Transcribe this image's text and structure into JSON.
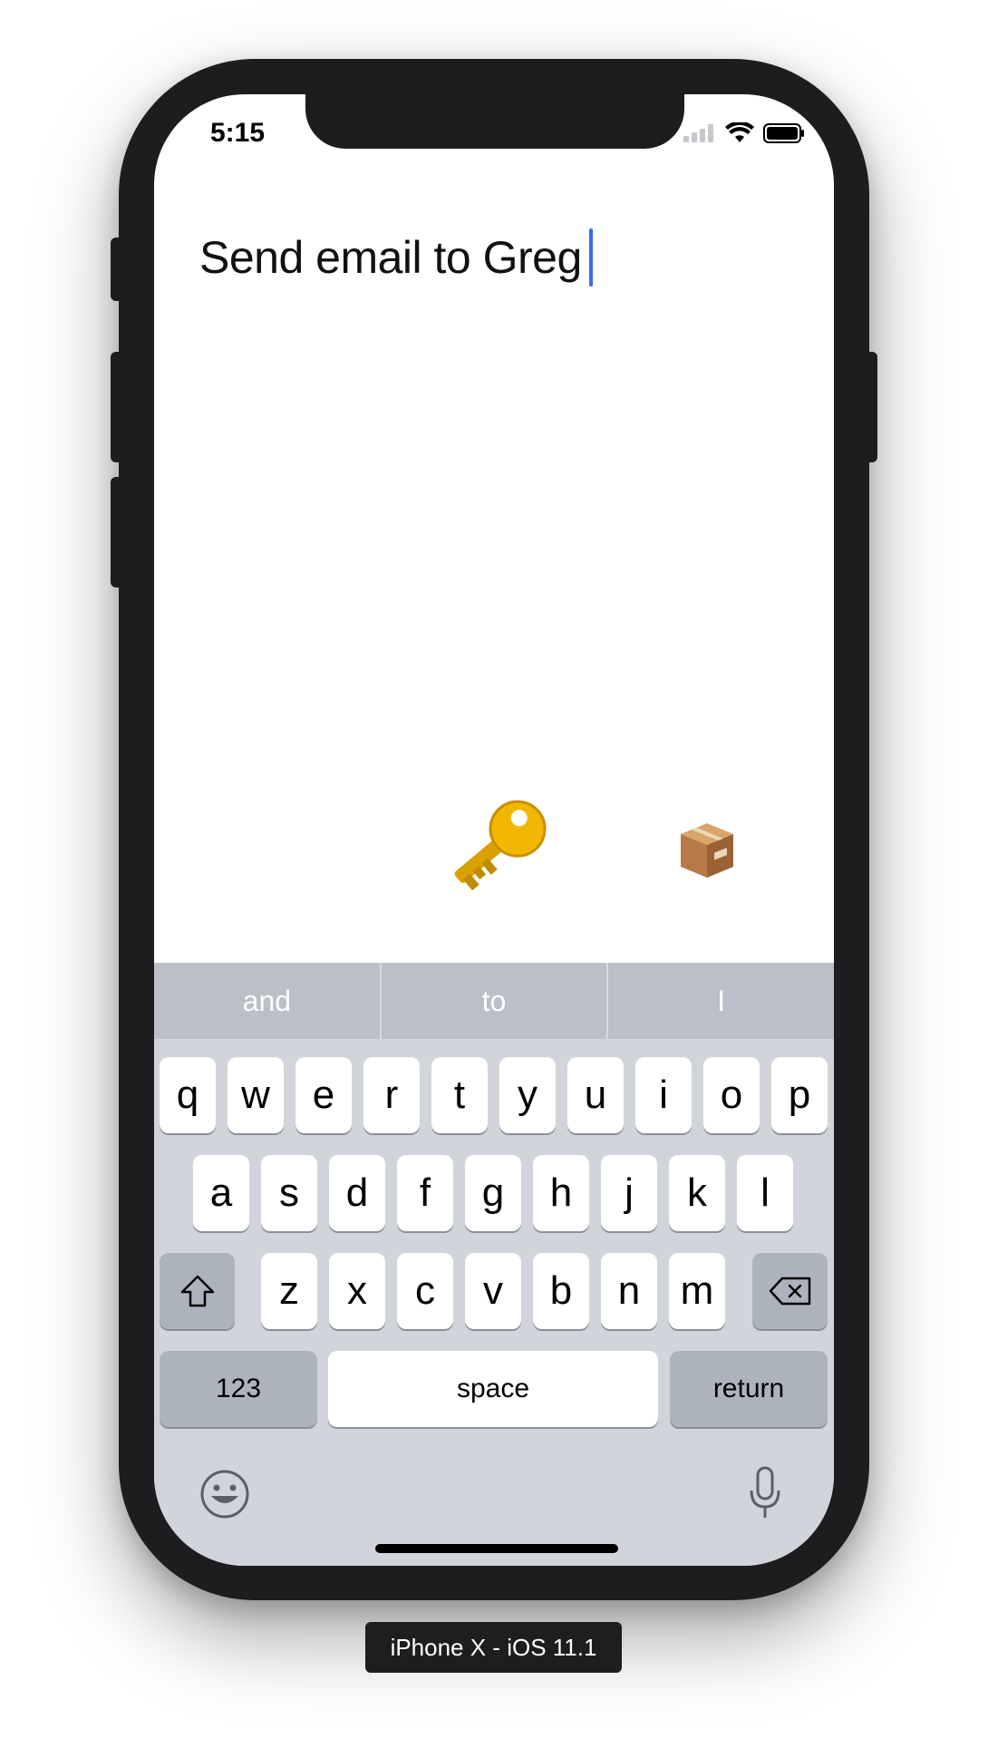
{
  "status_bar": {
    "time": "5:15"
  },
  "editor": {
    "text": "Send email to Greg"
  },
  "predictions": [
    "and",
    "to",
    "I"
  ],
  "keyboard": {
    "row1": [
      "q",
      "w",
      "e",
      "r",
      "t",
      "y",
      "u",
      "i",
      "o",
      "p"
    ],
    "row2": [
      "a",
      "s",
      "d",
      "f",
      "g",
      "h",
      "j",
      "k",
      "l"
    ],
    "row3": [
      "z",
      "x",
      "c",
      "v",
      "b",
      "n",
      "m"
    ],
    "numbers_label": "123",
    "space_label": "space",
    "return_label": "return"
  },
  "device_label": "iPhone X - iOS 11.1",
  "icons": {
    "shift": "shift-icon",
    "delete": "backspace-icon",
    "emoji": "emoji-icon",
    "dictation": "microphone-icon",
    "key": "key-emoji",
    "package": "package-emoji"
  },
  "colors": {
    "caret": "#3b6be6",
    "keyboard_bg": "#d1d5db",
    "predictive_bg": "#bbc0c8",
    "key_gold": "#f2b705",
    "box_brown": "#b57a45"
  }
}
